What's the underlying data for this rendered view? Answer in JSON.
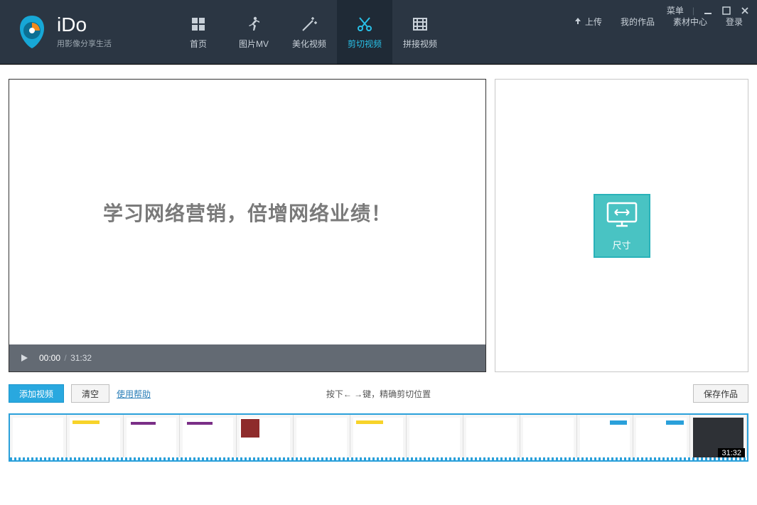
{
  "app": {
    "title": "iDo",
    "subtitle": "用影像分享生活"
  },
  "window": {
    "menu": "菜单"
  },
  "nav": {
    "tabs": [
      {
        "label": "首页",
        "icon": "grid-icon"
      },
      {
        "label": "图片MV",
        "icon": "runner-icon"
      },
      {
        "label": "美化视频",
        "icon": "wand-icon"
      },
      {
        "label": "剪切视频",
        "icon": "scissors-icon",
        "active": true
      },
      {
        "label": "拼接视频",
        "icon": "filmstrip-icon"
      }
    ]
  },
  "rightLinks": {
    "upload": "上传",
    "myworks": "我的作品",
    "materials": "素材中心",
    "login": "登录"
  },
  "player": {
    "overlay_text": "学习网络营销，倍增网络业绩！",
    "current_time": "00:00",
    "duration": "31:32"
  },
  "sidepanel": {
    "dimension_label": "尺寸"
  },
  "toolbar": {
    "add_video": "添加视频",
    "clear": "清空",
    "help": "使用帮助",
    "hint": "按下← →键，精确剪切位置",
    "save": "保存作品"
  },
  "timeline": {
    "end_badge": "31:32"
  }
}
